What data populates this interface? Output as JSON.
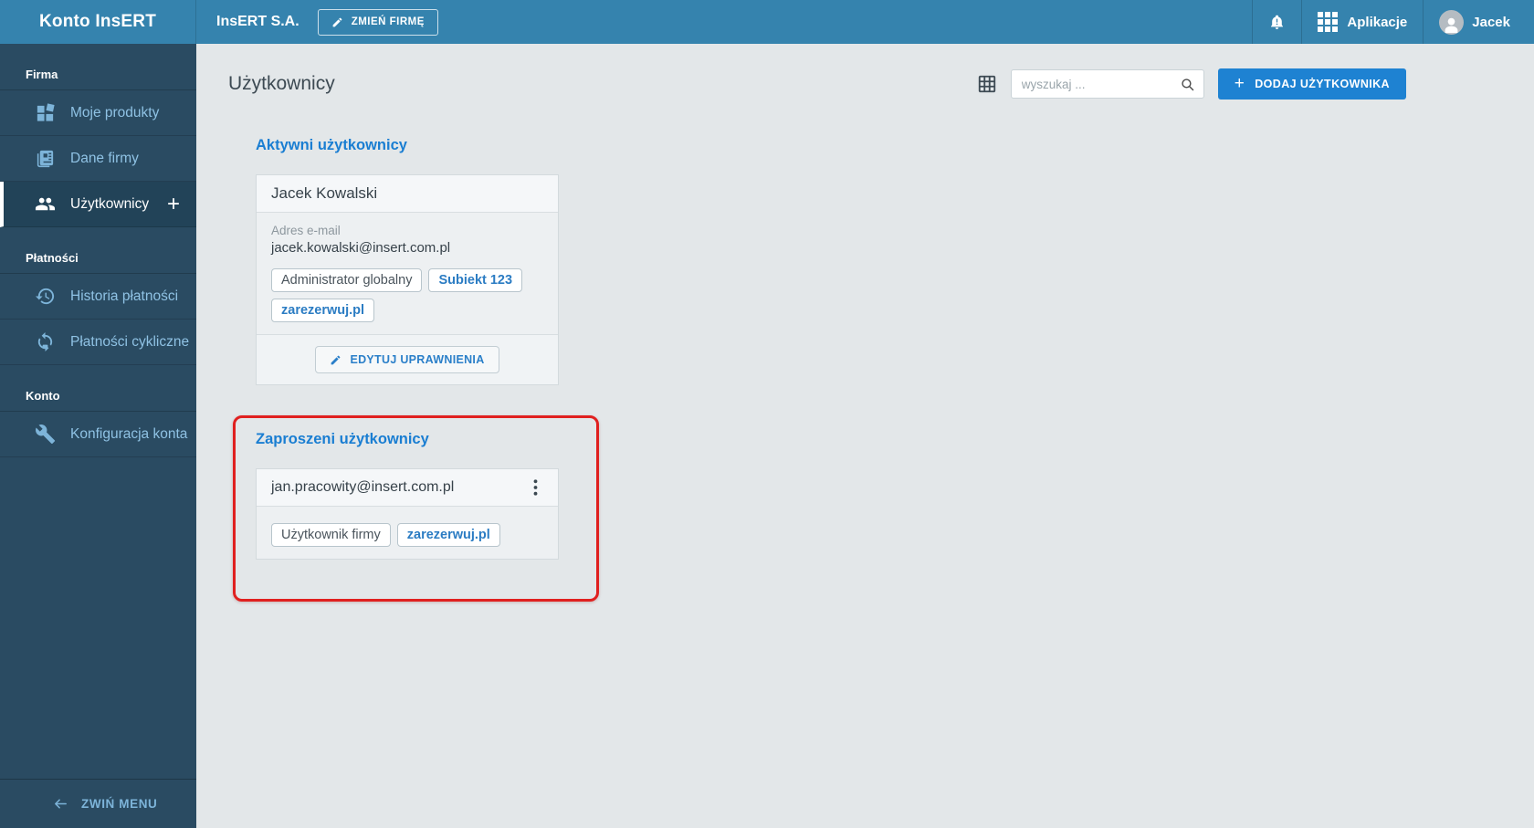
{
  "topbar": {
    "logo": "Konto InsERT",
    "company_name": "InsERT S.A.",
    "change_company_label": "ZMIEŃ FIRMĘ",
    "apps_label": "Aplikacje",
    "user_name": "Jacek"
  },
  "sidebar": {
    "sections": [
      {
        "label": "Firma",
        "items": [
          {
            "label": "Moje produkty",
            "icon": "products-icon",
            "active": false
          },
          {
            "label": "Dane firmy",
            "icon": "company-data-icon",
            "active": false
          },
          {
            "label": "Użytkownicy",
            "icon": "users-icon",
            "active": true,
            "plus": "+"
          }
        ]
      },
      {
        "label": "Płatności",
        "items": [
          {
            "label": "Historia płatności",
            "icon": "history-icon",
            "active": false
          },
          {
            "label": "Płatności cykliczne",
            "icon": "recurring-payments-icon",
            "active": false
          }
        ]
      },
      {
        "label": "Konto",
        "items": [
          {
            "label": "Konfiguracja konta",
            "icon": "account-config-icon",
            "active": false
          }
        ]
      }
    ],
    "collapse_label": "ZWIŃ MENU"
  },
  "main": {
    "title": "Użytkownicy",
    "search_placeholder": "wyszukaj ...",
    "add_user_label": "DODAJ UŻYTKOWNIKA",
    "active_section": {
      "heading": "Aktywni użytkownicy",
      "card": {
        "name": "Jacek Kowalski",
        "email_label": "Adres e-mail",
        "email": "jacek.kowalski@insert.com.pl",
        "badges": [
          {
            "label": "Administrator globalny",
            "style": "gray"
          },
          {
            "label": "Subiekt 123",
            "style": "blue"
          },
          {
            "label": "zarezerwuj.pl",
            "style": "blue"
          }
        ],
        "edit_permissions_label": "EDYTUJ UPRAWNIENIA"
      }
    },
    "invited_section": {
      "heading": "Zaproszeni użytkownicy",
      "card": {
        "email": "jan.pracowity@insert.com.pl",
        "badges": [
          {
            "label": "Użytkownik firmy",
            "style": "gray"
          },
          {
            "label": "zarezerwuj.pl",
            "style": "blue"
          }
        ]
      }
    }
  },
  "icons": [
    "pencil-icon",
    "bell-icon",
    "apps-grid-icon",
    "avatar-icon",
    "products-icon",
    "company-data-icon",
    "users-icon",
    "plus-icon",
    "history-icon",
    "recurring-payments-icon",
    "account-config-icon",
    "collapse-arrow-icon",
    "table-view-icon",
    "search-icon",
    "menu-dots-icon"
  ],
  "colors": {
    "topbar": "#3583ae",
    "sidebar": "#2a4b62",
    "sidebar_active": "#224358",
    "accent_blue": "#1e82d2",
    "heading_blue": "#1a7ed2",
    "badge_blue": "#2b7cc3",
    "annotation_red": "#e0201f",
    "main_bg": "#e3e7e9"
  }
}
